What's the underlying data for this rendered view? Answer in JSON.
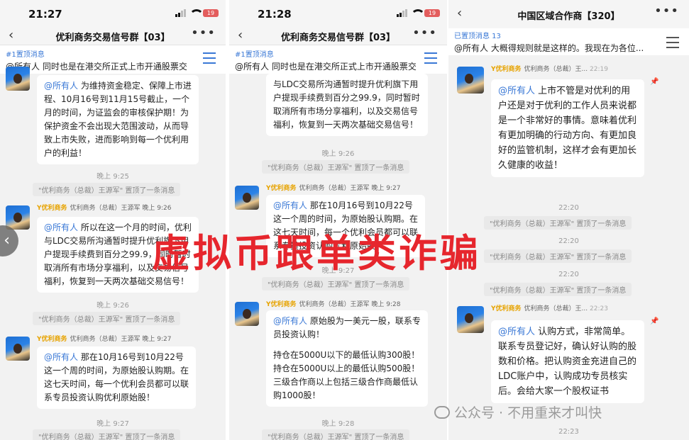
{
  "panel1": {
    "time": "21:27",
    "battery": "19",
    "title": "优利商务交易信号群【03】",
    "pin_tag": "#1置顶消息",
    "pin_text": "@所有人  同时也是在港交所正式上市开通股票交",
    "msg1": {
      "at": "@所有人",
      "text": "为维持资金稳定、保障上市进程、10月16号到11月15号截止，一个月的时间，为证监会的审核保护期！为保护资金不会出现大范围波动，从而导致上市失败，进而影响到每一个优利用户的利益！"
    },
    "time1": "晚上 9:25",
    "sys1": "\"优利商务（总裁）王源军\" 置顶了一条消息",
    "sender2": {
      "badge": "Y优利商务",
      "name": "优利商务（总裁）王源军",
      "time": "晚上 9:26"
    },
    "msg2": {
      "at": "@所有人",
      "text": "所以在这一个月的时间，优利与LDC交易所沟通暂时提升优利旗下用户提现手续费到百分之99.9，同时暂时取消所有市场分享福利，以及交易信号福利，恢复到一天两次基础交易信号！"
    },
    "time2": "晚上 9:26",
    "sys2": "\"优利商务（总裁）王源军\" 置顶了一条消息",
    "sender3": {
      "badge": "Y优利商务",
      "name": "优利商务（总裁）王源军",
      "time": "晚上 9:27"
    },
    "msg3": {
      "at": "@所有人",
      "text": "那在10月16号到10月22号这一个周的时间，为原始股认购期。在这七天时间，每一个优利会员都可以联系专员投资认购优利原始股！"
    },
    "time3": "晚上 9:27",
    "sys3": "\"优利商务（总裁）王源军\" 置顶了一条消息"
  },
  "panel2": {
    "time": "21:28",
    "battery": "19",
    "title": "优利商务交易信号群【03】",
    "pin_tag": "#1置顶消息",
    "pin_text": "@所有人  同时也是在港交所正式上市开通股票交",
    "msg1": {
      "text": "与LDC交易所沟通暂时提升优利旗下用户提现手续费到百分之99.9，同时暂时取消所有市场分享福利，以及交易信号福利，恢复到一天两次基础交易信号！"
    },
    "time1": "晚上 9:26",
    "sys1": "\"优利商务（总裁）王源军\" 置顶了一条消息",
    "sender2": {
      "badge": "Y优利商务",
      "name": "优利商务（总裁）王源军",
      "time": "晚上 9:27"
    },
    "msg2": {
      "at": "@所有人",
      "text": "那在10月16号到10月22号这一个周的时间，为原始股认购期。在这七天时间，每一个优利会员都可以联系专员投资认购优利原始股！"
    },
    "time2": "晚上 9:27",
    "sys2": "\"优利商务（总裁）王源军\" 置顶了一条消息",
    "sender3": {
      "badge": "Y优利商务",
      "name": "优利商务（总裁）王源军",
      "time": "晚上 9:28"
    },
    "msg3": {
      "at": "@所有人",
      "text": "原始股为一美元一股，联系专员投资认购！",
      "line2": "持仓在5000U以下的最低认购300股！持仓在5000U以上的最低认购500股！三级合作商以上包括三级合作商最低认购1000股！"
    },
    "time3": "晚上 9:28",
    "sys3": "\"优利商务（总裁）王源军\" 置顶了一条消息"
  },
  "panel3": {
    "title": "中国区域合作商【320】",
    "pin_tag": "已置顶消息 13",
    "pin_text": "@所有人  大概得规则就是这样的。我现在为各位...",
    "sender1": {
      "badge": "Y优利商务",
      "name": "优利商务（总裁）王...",
      "time": "22:19"
    },
    "msg1": {
      "at": "@所有人",
      "text": "上市不管是对优利的用户还是对于优利的工作人员来说都是一个非常好的事情。意味着优利有更加明确的行动方向、有更加良好的监管机制，这样才会有更加长久健康的收益！"
    },
    "time1": "22:20",
    "sys1": "\"优利商务（总裁）王源军\" 置顶了一条消息",
    "time2": "22:20",
    "sys2": "\"优利商务（总裁）王源军\" 置顶了一条消息",
    "time3": "22:20",
    "sys3": "\"优利商务（总裁）王源军\" 置顶了一条消息",
    "sender2": {
      "badge": "Y优利商务",
      "name": "优利商务（总裁）王...",
      "time": "22:23"
    },
    "msg2": {
      "at": "@所有人",
      "text": "认购方式，非常简单。联系专员登记好，确认好认购的股数和价格。把认购资金充进自己的LDC账户中，认购成功专员核实后。会给大家一个股权证书"
    },
    "time4": "22:23"
  },
  "overlay": {
    "title": "虚拟币跟单类诈骗"
  },
  "watermark": {
    "text": "公众号 · 不用重来才叫快"
  },
  "colors": {
    "accent": "#3a78d6",
    "overlay_red": "#e6262d",
    "chat_bg": "#f2f2f2"
  }
}
